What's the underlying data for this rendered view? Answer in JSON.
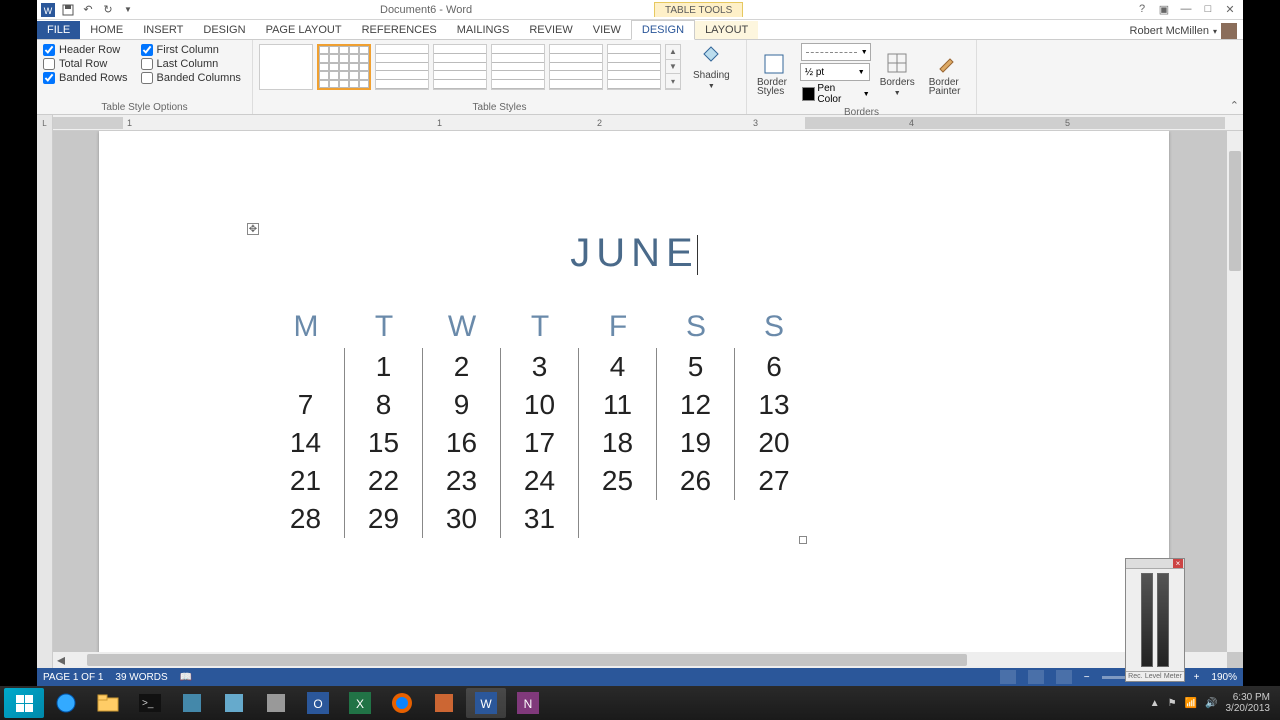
{
  "title_bar": {
    "doc_title": "Document6 - Word",
    "context_tools": "TABLE TOOLS"
  },
  "tabs": {
    "file": "FILE",
    "items": [
      "HOME",
      "INSERT",
      "DESIGN",
      "PAGE LAYOUT",
      "REFERENCES",
      "MAILINGS",
      "REVIEW",
      "VIEW"
    ],
    "context_items": [
      "DESIGN",
      "LAYOUT"
    ],
    "active": "DESIGN",
    "user": "Robert McMillen"
  },
  "ribbon": {
    "tso": {
      "label": "Table Style Options",
      "header_row": "Header Row",
      "total_row": "Total Row",
      "banded_rows": "Banded Rows",
      "first_column": "First Column",
      "last_column": "Last Column",
      "banded_columns": "Banded Columns",
      "checked": {
        "header_row": true,
        "total_row": false,
        "banded_rows": true,
        "first_column": true,
        "last_column": false,
        "banded_columns": false
      }
    },
    "table_styles": {
      "label": "Table Styles",
      "shading": "Shading"
    },
    "borders": {
      "label": "Borders",
      "border_styles": "Border Styles",
      "pen_weight": "½ pt",
      "pen_color": "Pen Color",
      "borders_btn": "Borders",
      "border_painter": "Border Painter"
    }
  },
  "ruler": {
    "corner": "L",
    "numbers": [
      "1",
      "2",
      "3",
      "4",
      "5"
    ]
  },
  "calendar": {
    "title": "JUNE",
    "days": [
      "M",
      "T",
      "W",
      "T",
      "F",
      "S",
      "S"
    ],
    "weeks": [
      [
        "",
        "1",
        "2",
        "3",
        "4",
        "5",
        "6"
      ],
      [
        "7",
        "8",
        "9",
        "10",
        "11",
        "12",
        "13"
      ],
      [
        "14",
        "15",
        "16",
        "17",
        "18",
        "19",
        "20"
      ],
      [
        "21",
        "22",
        "23",
        "24",
        "25",
        "26",
        "27"
      ],
      [
        "28",
        "29",
        "30",
        "31",
        "",
        "",
        ""
      ]
    ]
  },
  "status": {
    "page": "PAGE 1 OF 1",
    "words": "39 WORDS",
    "zoom": "190%"
  },
  "level_meter": {
    "rec": "Rec.",
    "level": "Level",
    "meter": "Meter"
  },
  "taskbar": {
    "time": "6:30 PM",
    "date": "3/20/2013"
  }
}
